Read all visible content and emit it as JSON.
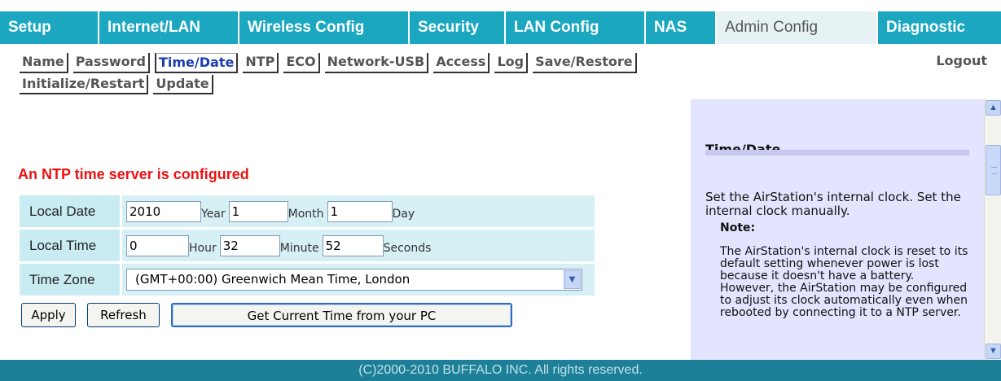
{
  "topnav": {
    "tabs": [
      {
        "label": "Setup"
      },
      {
        "label": "Internet/LAN"
      },
      {
        "label": "Wireless Config"
      },
      {
        "label": "Security"
      },
      {
        "label": "LAN Config"
      },
      {
        "label": "NAS"
      },
      {
        "label": "Admin Config"
      },
      {
        "label": "Diagnostic"
      }
    ]
  },
  "subnav": {
    "row1": [
      {
        "label": "Name"
      },
      {
        "label": "Password"
      },
      {
        "label": "Time/Date"
      },
      {
        "label": "NTP"
      },
      {
        "label": "ECO"
      },
      {
        "label": "Network-USB"
      },
      {
        "label": "Access"
      },
      {
        "label": "Log"
      },
      {
        "label": "Save/Restore"
      }
    ],
    "row2": [
      {
        "label": "Initialize/Restart"
      },
      {
        "label": "Update"
      }
    ],
    "logout": "Logout"
  },
  "main": {
    "ntp_message": "An NTP time server is configured",
    "local_date": {
      "label": "Local Date",
      "year": "2010",
      "year_unit": "Year",
      "month": "1",
      "month_unit": "Month",
      "day": "1",
      "day_unit": "Day"
    },
    "local_time": {
      "label": "Local Time",
      "hour": "0",
      "hour_unit": "Hour",
      "minute": "32",
      "minute_unit": "Minute",
      "seconds": "52",
      "seconds_unit": "Seconds"
    },
    "time_zone": {
      "label": "Time Zone",
      "selected": "(GMT+00:00) Greenwich Mean Time, London"
    },
    "buttons": {
      "apply": "Apply",
      "refresh": "Refresh",
      "get_pc": "Get Current Time from your PC"
    }
  },
  "help": {
    "title": "Time/Date",
    "text": "Set the AirStation's internal clock. Set the internal clock manually.",
    "note_title": "Note:",
    "note_body": "The AirStation's internal clock is reset to its default setting whenever power is lost because it doesn't have a battery. However, the AirStation may be configured to adjust its clock automatically even when rebooted by connecting it to a NTP server."
  },
  "footer": "(C)2000-2010 BUFFALO INC. All rights reserved.",
  "colors": {
    "nav": "#1aa7bf",
    "active_tab": "#e6f2f4",
    "ntp_message": "#ee1111",
    "help_bg": "#e3e4ff",
    "footer_bg": "#1d7f98"
  },
  "icons": {
    "select_arrow": "chevron-down-icon",
    "scroll_up": "arrow-up-icon",
    "scroll_down": "arrow-down-icon"
  }
}
